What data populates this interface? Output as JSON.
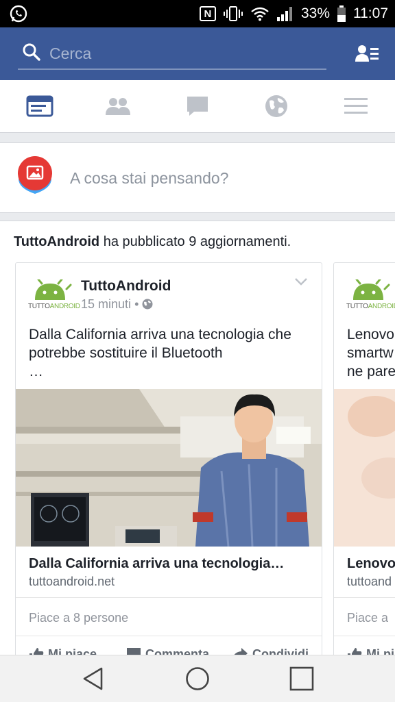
{
  "status_bar": {
    "battery": "33%",
    "time": "11:07",
    "nfc": "N"
  },
  "search": {
    "placeholder": "Cerca"
  },
  "tabs": [
    {
      "name": "news-feed",
      "icon": "newsfeed-icon",
      "active": true
    },
    {
      "name": "friend-requests",
      "icon": "friends-icon"
    },
    {
      "name": "messages",
      "icon": "chat-icon"
    },
    {
      "name": "notifications",
      "icon": "globe-icon"
    },
    {
      "name": "menu",
      "icon": "hamburger-icon"
    }
  ],
  "composer": {
    "placeholder": "A cosa stai pensando?"
  },
  "feed": {
    "header_author": "TuttoAndroid",
    "header_text": " ha pubblicato 9 aggiornamenti.",
    "posts": [
      {
        "author": "TuttoAndroid",
        "logo_text_a": "TUTTO",
        "logo_text_b": "ANDROID",
        "time": "15 minuti",
        "dot": "•",
        "text_line1": "Dalla California arriva una tecnologia che",
        "text_line2": "potrebbe sostituire il Bluetooth",
        "text_line3": "…",
        "link_title": "Dalla California arriva una tecnologia…",
        "link_domain": "tuttoandroid.net",
        "likes": "Piace a 8 persone",
        "actions": {
          "like": "Mi piace",
          "comment": "Commenta",
          "share": "Condividi"
        }
      },
      {
        "author": "TuttoAndroid",
        "logo_text_a": "TUTTO",
        "logo_text_b": "ANDROID",
        "text_line1": "Lenovo",
        "text_line2": "smartw",
        "text_line3": "ne pare",
        "link_title": "Lenovo",
        "link_domain": "tuttoand",
        "likes": "Piace a",
        "actions": {
          "like": "Mi pi"
        }
      }
    ]
  },
  "colors": {
    "brand": "#3b5998",
    "android_green": "#7cb342",
    "active_tab": "#3b5998",
    "inactive_tab": "#bec2c9"
  }
}
